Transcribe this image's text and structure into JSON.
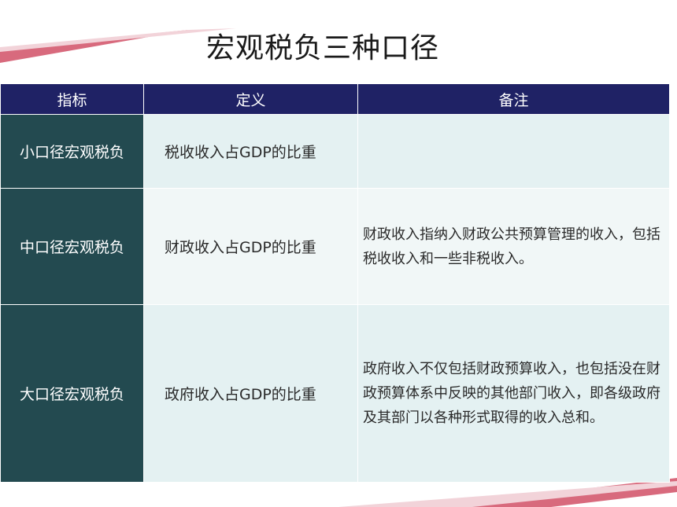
{
  "title": "宏观税负三种口径",
  "table": {
    "headers": [
      "指标",
      "定义",
      "备注"
    ],
    "rows": [
      {
        "indicator": "小口径宏观税负",
        "definition": "税收收入占GDP的比重",
        "note": ""
      },
      {
        "indicator": "中口径宏观税负",
        "definition": "财政收入占GDP的比重",
        "note": "财政收入指纳入财政公共预算管理的收入，包括税收收入和一些非税收入。"
      },
      {
        "indicator": "大口径宏观税负",
        "definition": "政府收入占GDP的比重",
        "note": "政府收入不仅包括财政预算收入，也包括没在财政预算体系中反映的其他部门收入，即各级政府及其部门以各种形式取得的收入总和。"
      }
    ]
  },
  "colors": {
    "header": "#1f2265",
    "label_cell": "#234a50",
    "accent_stripe": "#d86a7d"
  }
}
